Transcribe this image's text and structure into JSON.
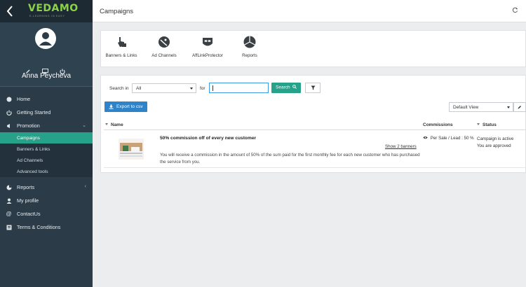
{
  "sidebar": {
    "logo": "VEDAMO",
    "logo_sub": "E-LEARNING IN EASY",
    "user_name": "Anna Peycheva",
    "menu": [
      {
        "label": "Home",
        "icon": "home-icon"
      },
      {
        "label": "Getting Started",
        "icon": "power-icon"
      },
      {
        "label": "Promotion",
        "icon": "megaphone-icon"
      }
    ],
    "submenu": [
      "Campaigns",
      "Banners & Links",
      "Ad Channels",
      "Advanced tools"
    ],
    "menu2": [
      {
        "label": "Reports",
        "icon": "pie-chart-icon"
      },
      {
        "label": "My profile",
        "icon": "user-icon"
      },
      {
        "label": "ContactUs",
        "icon": "at-sign-icon"
      },
      {
        "label": "Terms & Conditions",
        "icon": "list-icon"
      }
    ]
  },
  "header": {
    "title": "Campaigns"
  },
  "tools": [
    {
      "label": "Banners & Links",
      "icon": "hand-pointer-icon"
    },
    {
      "label": "Ad Channels",
      "icon": "satellite-dish-icon"
    },
    {
      "label": "AffLinkProtector",
      "icon": "mask-icon"
    },
    {
      "label": "Reports",
      "icon": "pie-chart-icon"
    }
  ],
  "search": {
    "search_in_label": "Search in",
    "search_in_value": "All",
    "for_label": "for",
    "query": "",
    "search_button": "Search",
    "export_button": "Export to csv",
    "view_value": "Default View"
  },
  "table": {
    "headers": {
      "name": "Name",
      "commissions": "Commissions",
      "status": "Status"
    },
    "rows": [
      {
        "title": "50% commission off of every new customer",
        "show_banners": "Show 2 banners",
        "description": "You will receive a commission in the amount of 50% of the sum paid for the first monthly fee for each new customer who has purchased the service from you.",
        "commission": "Per Sale / Lead : 50 %",
        "status_line1": "Campaign is active",
        "status_line2": "You are approved"
      }
    ]
  },
  "colors": {
    "sidebar": "#2b3b47",
    "accent_green": "#26a18a",
    "accent_blue": "#2f83c8",
    "logo_green": "#8bd14a"
  }
}
